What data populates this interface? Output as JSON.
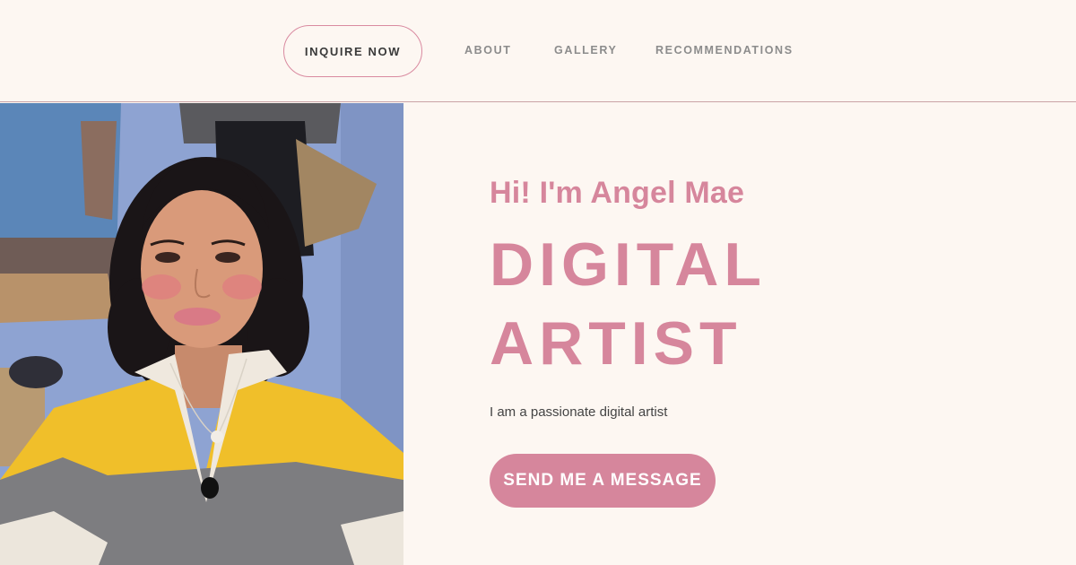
{
  "nav": {
    "inquire_label": "INQUIRE NOW",
    "links": [
      {
        "label": "ABOUT"
      },
      {
        "label": "GALLERY"
      },
      {
        "label": "RECOMMENDATIONS"
      }
    ]
  },
  "hero": {
    "greeting": "Hi! I'm Angel Mae",
    "title_line1": "DIGITAL",
    "title_line2": "ARTIST",
    "tagline": "I am a passionate digital artist",
    "cta_label": "SEND ME A MESSAGE"
  },
  "colors": {
    "background": "#fdf7f2",
    "accent": "#d6869c",
    "nav_text": "#8c8c8c",
    "divider": "#c9a3a7"
  }
}
